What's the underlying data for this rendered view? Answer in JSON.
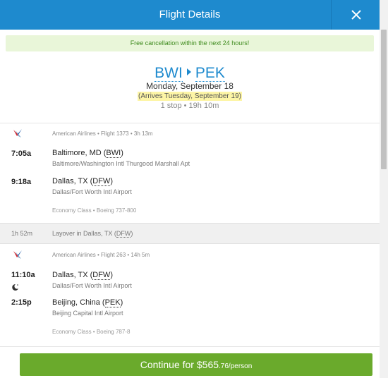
{
  "header": {
    "title": "Flight Details",
    "close_icon": "close-icon"
  },
  "notice": "Free cancellation within the next 24 hours!",
  "trip": {
    "origin": "BWI",
    "destination": "PEK",
    "date": "Monday, September 18",
    "arrives": "(Arrives Tuesday, September 19)",
    "summary": "1 stop • 19h 10m"
  },
  "segments": [
    {
      "airline_info": "American Airlines • Flight 1373 • 3h 13m",
      "depart": {
        "time": "7:05a",
        "city": "Baltimore, MD (",
        "code": "BWI",
        "close": ")",
        "airport": "Baltimore/Washington Intl Thurgood Marshall Apt"
      },
      "arrive": {
        "time": "9:18a",
        "city": "Dallas, TX (",
        "code": "DFW",
        "close": ")",
        "airport": "Dallas/Fort Worth Intl Airport"
      },
      "aircraft": "Economy Class • Boeing 737-800"
    },
    {
      "airline_info": "American Airlines • Flight 263 • 14h 5m",
      "depart": {
        "time": "11:10a",
        "city": "Dallas, TX (",
        "code": "DFW",
        "close": ")",
        "airport": "Dallas/Fort Worth Intl Airport"
      },
      "arrive": {
        "time": "2:15p",
        "city": "Beijing, China (",
        "code": "PEK",
        "close": ")",
        "airport": "Beijing Capital Intl Airport"
      },
      "aircraft": "Economy Class • Boeing 787-8"
    }
  ],
  "layover": {
    "duration": "1h 52m",
    "text": "Layover in Dallas, TX (",
    "code": "DFW",
    "close": ")"
  },
  "footer": {
    "label": "Continue for ",
    "price_main": "$565",
    "price_cents": ".76/person"
  },
  "colors": {
    "accent": "#1e8ace",
    "button": "#6aaa2c",
    "notice_bg": "#e9f6d9",
    "highlight": "#fdf5a6"
  }
}
